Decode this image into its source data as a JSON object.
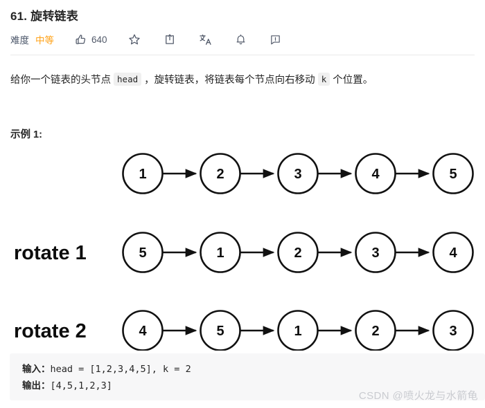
{
  "header": {
    "title": "61. 旋转链表",
    "difficulty_label": "难度",
    "difficulty_value": "中等",
    "difficulty_color": "#ffa116",
    "like_count": "640",
    "icons": {
      "like": "thumbs-up-icon",
      "star": "star-icon",
      "share": "share-icon",
      "translate": "translate-icon",
      "bell": "bell-icon",
      "report": "report-icon"
    }
  },
  "description": {
    "part1": "给你一个链表的头节点 ",
    "code1": "head",
    "part2": " ，旋转链表，将链表每个节点向右移动 ",
    "code2": "k",
    "part3": " 个位置。"
  },
  "example": {
    "heading": "示例 1:"
  },
  "chart_data": {
    "type": "diagram",
    "title": "",
    "rows": [
      {
        "label": "",
        "nodes": [
          "1",
          "2",
          "3",
          "4",
          "5"
        ]
      },
      {
        "label": "rotate 1",
        "nodes": [
          "5",
          "1",
          "2",
          "3",
          "4"
        ]
      },
      {
        "label": "rotate 2",
        "nodes": [
          "4",
          "5",
          "1",
          "2",
          "3"
        ]
      }
    ],
    "node_shape": "circle",
    "edge_style": "arrow",
    "stroke_color": "#111111",
    "fill_color": "#ffffff"
  },
  "code": {
    "input_label": "输入：",
    "input_value": "head = [1,2,3,4,5], k = 2",
    "output_label": "输出：",
    "output_value": "[4,5,1,2,3]"
  },
  "watermark": {
    "text": "CSDN @喷火龙与水箭龟"
  }
}
